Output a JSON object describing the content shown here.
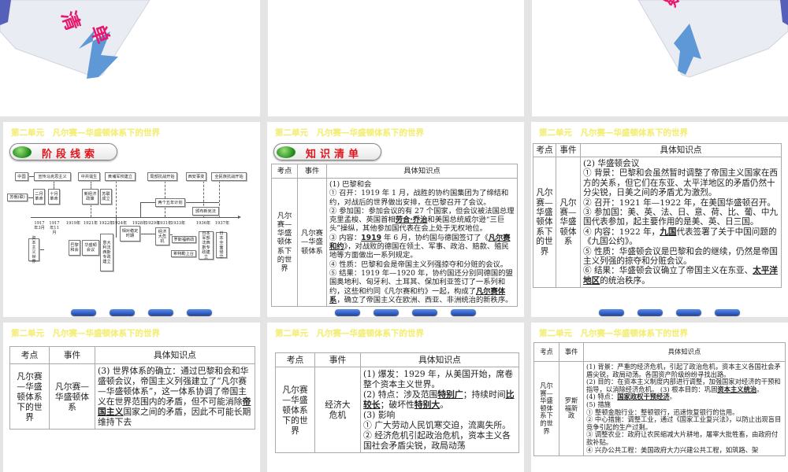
{
  "unit_title": "第二单元　凡尔赛—华盛顿体系下的世界",
  "top_decor": {
    "left_text": "清单",
    "right_text": "疑"
  },
  "slide1": {
    "header": "阶段线索",
    "timeline": {
      "boxes": [
        "中国",
        "宣传马克思主义",
        "中共诞生",
        "黄埔军校建立",
        "局部抗战开始",
        "西安事变",
        "全民族抗战开始",
        "苏俄(联)",
        "二月革命",
        "十月革命",
        "新经济政策",
        "苏联成立",
        "两个五年计划",
        "颁布新宪法",
        "资本主义世界",
        "巴黎和会",
        "华盛顿会议",
        "意大利法西斯专政建立",
        "相对稳定时期",
        "经济大危机",
        "罗斯福新政",
        "希特勒上台",
        "日本军部法西斯专政建立",
        "日本全面侵华"
      ],
      "years": [
        "1917年3月",
        "1917年11月",
        "1919年",
        "1921年",
        "1922年",
        "1924年",
        "1928年",
        "1929年",
        "1931年",
        "1933年",
        "1936年",
        "1937年"
      ]
    }
  },
  "table_headers": [
    "考点",
    "事件",
    "具体知识点"
  ],
  "slide2": {
    "header": "知识清单",
    "topic": "凡尔赛—华盛顿体系下的世界",
    "event": "凡尔赛—华盛顿体系",
    "content": [
      [
        {
          "t": "(1) 巴黎和会"
        }
      ],
      [
        {
          "t": "① 召开：1919 年 1 月，战胜的协约国集团为了缔结和约，对战后的世界做出安排，在巴黎召开了会议。"
        }
      ],
      [
        {
          "t": "② 参加国：参加会议的有 27 个国家，但会议被法国总理克里孟梭、英国首相"
        },
        {
          "t": "劳合·乔治",
          "b": 1
        },
        {
          "t": "和美国总统威尔逊“三巨头”操纵，其他参加国代表在会上处于无权地位。"
        }
      ],
      [
        {
          "t": "③ 内容："
        },
        {
          "t": "1919",
          "b": 1
        },
        {
          "t": " 年 6 月，协约国与德国签订了《"
        },
        {
          "t": "凡尔赛和约",
          "b": 1
        },
        {
          "t": "》，对战败的德国在领土、军事、政治、赔款、殖民地等方面做出一系列规定。"
        }
      ],
      [
        {
          "t": "④ 性质：巴黎和会是帝国主义列强掠夺和分赃的会议。"
        }
      ],
      [
        {
          "t": "⑤ 结果：1919 年—1920 年，协约国还分别同德国的盟国奥地利、匈牙利、土耳其、保加利亚签订了一系列和约，这些和约同《凡尔赛和约》一起，构成了"
        },
        {
          "t": "凡尔赛体系",
          "b": 1
        },
        {
          "t": "，确立了帝国主义在欧洲、西亚、非洲统治的新秩序。"
        }
      ]
    ]
  },
  "slide3": {
    "topic": "凡尔赛—华盛顿体系下的世界",
    "event": "凡尔赛—华盛顿体系",
    "content": [
      [
        {
          "t": "(2) 华盛顿会议"
        }
      ],
      [
        {
          "t": "① 背景：巴黎和会虽然暂时调整了帝国主义国家在西方的关系，但它们在东亚、太平洋地区的矛盾仍然十分尖锐，日美之间的矛盾尤为激烈。"
        }
      ],
      [
        {
          "t": "② 召开：1921 年—1922 年，在美国华盛顿召开。"
        }
      ],
      [
        {
          "t": "③ 参加国：美、英、法、日、意、荷、比、葡、中九国代表参加，起主要作用的是美、英、日三国。"
        }
      ],
      [
        {
          "t": "④ 内容：1922 年，"
        },
        {
          "t": "九国",
          "b": 1
        },
        {
          "t": "代表签署了关于中国问题的《九国公约》。"
        }
      ],
      [
        {
          "t": "⑤ 性质：华盛顿会议是巴黎和会的继续，仍然是帝国主义列强的掠夺和分赃会议。"
        }
      ],
      [
        {
          "t": "⑥ 结果：华盛顿会议确立了帝国主义在东亚、"
        },
        {
          "t": "太平洋地区",
          "b": 1
        },
        {
          "t": "的统治秩序。"
        }
      ]
    ]
  },
  "slide4": {
    "topic": "凡尔赛—华盛顿体系下的世界",
    "event": "凡尔赛—华盛顿体系",
    "content": [
      [
        {
          "t": "(3) 世界体系的确立：通过巴黎和会和华盛顿会议，帝国主义列强建立了“凡尔赛—华盛顿体系”，这一体系协调了帝国主义在世界范围内的矛盾，但不可能消除"
        },
        {
          "t": "帝国主义",
          "b": 1
        },
        {
          "t": "国家之间的矛盾，因此不可能长期维持下去"
        }
      ]
    ]
  },
  "slide5": {
    "topic": "凡尔赛—华盛顿体系下的世界",
    "event": "经济大危机",
    "content": [
      [
        {
          "t": "(1) 爆发：1929 年，从美国开始，席卷整个资本主义世界。"
        }
      ],
      [
        {
          "t": "(2) 特点：涉及范围"
        },
        {
          "t": "特别广",
          "b": 1
        },
        {
          "t": "；持续时间"
        },
        {
          "t": "比较长",
          "b": 1
        },
        {
          "t": "；破坏性"
        },
        {
          "t": "特别大",
          "b": 1
        },
        {
          "t": "。"
        }
      ],
      [
        {
          "t": "(3) 影响"
        }
      ],
      [
        {
          "t": "① 广大劳动人民饥寒交迫，流离失所。"
        }
      ],
      [
        {
          "t": "② 经济危机引起政治危机，资本主义各国社会矛盾尖锐，政局动荡"
        }
      ]
    ]
  },
  "slide6": {
    "topic": "凡尔赛—华盛顿体系下的世界",
    "event": "罗斯福新政",
    "content": [
      [
        {
          "t": "(1) 背景：严重的经济危机，引起了政治危机，资本主义各国社会矛盾尖锐，政局动荡。各国资产阶级纷纷寻找出路。"
        }
      ],
      [
        {
          "t": "(2) 目的：在资本主义制度内部进行调整，加强国家对经济的干预和指导，以消除经济危机。 (3) 根本目的：巩固"
        },
        {
          "t": "资本主义统治",
          "b": 1
        },
        {
          "t": "。"
        }
      ],
      [
        {
          "t": "(4) 特点："
        },
        {
          "t": "国家政权干预经济",
          "b": 1
        },
        {
          "t": "。"
        }
      ],
      [
        {
          "t": "(5) 措施"
        }
      ],
      [
        {
          "t": "① 整顿金融行业：整顿银行，迅速恢复银行的信用。"
        }
      ],
      [
        {
          "t": "② 中心措施：调整工业，通过《国家工业复兴法》，以防止出现盲目竞争引起的生产过剩。"
        }
      ],
      [
        {
          "t": "③ 调整农业：政府让农民缩减大片耕地，屠宰大批牲畜，由政府付款补贴。"
        }
      ],
      [
        {
          "t": "④ 兴办公共工程：美国政府大力兴建公共工程，如筑路、架"
        }
      ]
    ]
  }
}
